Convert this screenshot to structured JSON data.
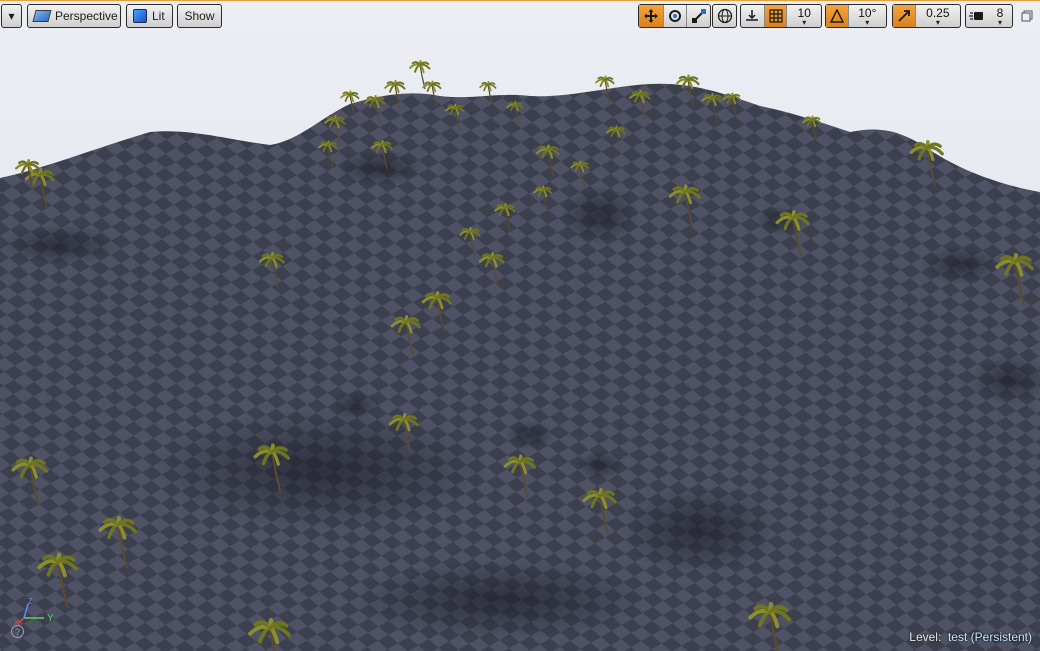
{
  "toolbar": {
    "viewport_options_caret": "▾",
    "perspective_label": "Perspective",
    "lit_label": "Lit",
    "show_label": "Show",
    "grid_snap_value": "10",
    "rotation_snap_value": "10°",
    "scale_snap_value": "0.25",
    "camera_speed_value": "8"
  },
  "status": {
    "level_label": "Level:",
    "level_value": "test (Persistent)"
  },
  "axis": {
    "x_label": "X",
    "y_label": "Y",
    "z_label": "Z"
  },
  "help": "?",
  "colors": {
    "toolbar_active": "#e38b24",
    "sky": "#e9eaf0",
    "terrain_light": "#4d5163",
    "terrain_dark": "#3a3d4c",
    "palm_fronds": "#8b8f2a",
    "level_value_color": "#bfe6ff"
  },
  "icons": [
    "viewport-menu-caret-icon",
    "perspective-icon",
    "lit-cube-icon",
    "translate-icon",
    "rotate-icon",
    "scale-icon",
    "world-icon",
    "surface-snap-icon",
    "grid-snap-icon",
    "rotation-snap-icon",
    "scale-snap-icon",
    "camera-speed-icon",
    "maximize-icon",
    "help-icon"
  ]
}
